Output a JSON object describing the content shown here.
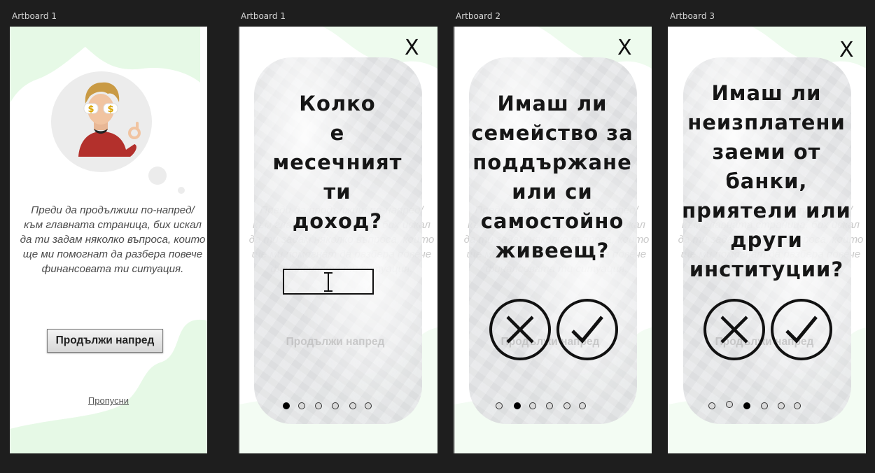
{
  "artboards": [
    {
      "label": "Artboard 1"
    },
    {
      "label": "Artboard 1"
    },
    {
      "label": "Artboard 2"
    },
    {
      "label": "Artboard 3"
    }
  ],
  "intro": {
    "text": "Преди да продължиш по-напред/\nкъм главната страница, бих искал\nда ти задам няколко въпроса, които\nще ми помогнат да разбера повече\nфинансовата ти ситуация.",
    "continue_label": "Продължи напред",
    "skip_label": "Пропусни"
  },
  "screens": [
    {
      "question": "Колко\nе\nмесечният\nти\nдоход?",
      "active_dot": 0,
      "input_value": ""
    },
    {
      "question": "Имаш ли\nсемейство за\nподдържане\nили си\nсамостойно\nживеещ?",
      "active_dot": 1
    },
    {
      "question": "Имаш ли\nнеизплатени\nзаеми от\nбанки,\nприятели или\nдруги\nинституции?",
      "active_dot": 2
    }
  ],
  "close_glyph": "X",
  "dot_count": 6,
  "icons": {
    "no": "x-circle-icon",
    "yes": "check-circle-icon",
    "avatar": "avatar-illustration"
  },
  "colors": {
    "accent_green": "#e6f9e6",
    "dark_bg": "#1e1e1e",
    "dot_active": "#000000",
    "dot_inactive": "#d9d9d9"
  }
}
